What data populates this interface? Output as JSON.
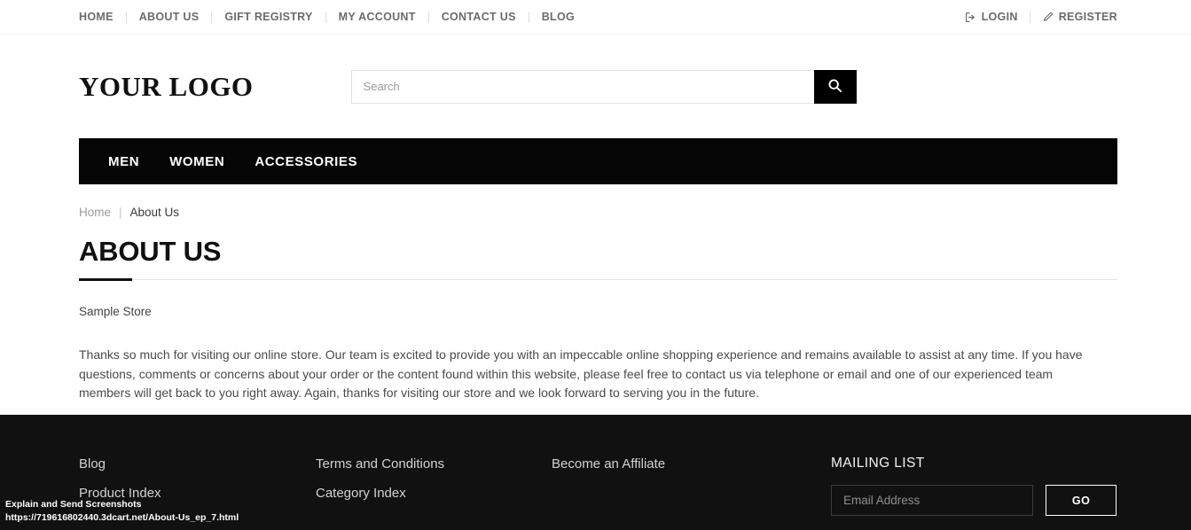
{
  "topbar": {
    "nav": [
      {
        "label": "HOME"
      },
      {
        "label": "ABOUT US"
      },
      {
        "label": "GIFT REGISTRY"
      },
      {
        "label": "MY ACCOUNT"
      },
      {
        "label": "CONTACT US"
      },
      {
        "label": "BLOG"
      }
    ],
    "login_label": "LOGIN",
    "register_label": "REGISTER"
  },
  "header": {
    "logo": "YOUR LOGO",
    "search_placeholder": "Search",
    "search_value": ""
  },
  "mainnav": {
    "items": [
      {
        "label": "MEN"
      },
      {
        "label": "WOMEN"
      },
      {
        "label": "ACCESSORIES"
      }
    ]
  },
  "breadcrumb": {
    "home": "Home",
    "separator": "|",
    "current": "About Us"
  },
  "main": {
    "title": "ABOUT US",
    "subhead": "Sample Store",
    "body": "Thanks so much for visiting our online store. Our team is excited to provide you with an impeccable online shopping experience and remains available to assist at any time. If you have questions, comments or concerns about your order or the content found within this website, please feel free to contact us via telephone or email and one of our experienced team members will get back to you right away.  Again, thanks for visiting our store and we look forward to serving you in the future."
  },
  "footer": {
    "col1": [
      {
        "label": "Blog"
      },
      {
        "label": "Product Index"
      }
    ],
    "col2": [
      {
        "label": "Terms and Conditions"
      },
      {
        "label": "Category Index"
      }
    ],
    "col3": [
      {
        "label": "Become an Affiliate"
      }
    ],
    "mailing": {
      "title": "MAILING LIST",
      "placeholder": "Email Address",
      "value": "",
      "button": "GO"
    }
  },
  "statusbar": {
    "line1": "Explain and Send Screenshots",
    "line2": "https://719616802440.3dcart.net/About-Us_ep_7.html"
  },
  "colors": {
    "nav_black": "#050505",
    "footer_black": "#111111",
    "accent_underline": "#111111",
    "muted_text": "#6b6b6b"
  }
}
